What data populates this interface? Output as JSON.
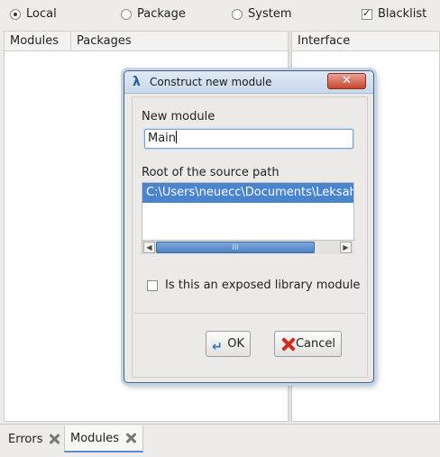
{
  "scope_options": [
    {
      "label": "Local",
      "selected": true
    },
    {
      "label": "Package",
      "selected": false
    },
    {
      "label": "System",
      "selected": false
    }
  ],
  "blacklist": {
    "label": "Blacklist",
    "checked": true
  },
  "left_pane": {
    "col_modules": "Modules",
    "col_packages": "Packages"
  },
  "right_pane": {
    "col_interface": "Interface"
  },
  "bottom_tabs": [
    {
      "label": "Errors",
      "active": false
    },
    {
      "label": "Modules",
      "active": true
    }
  ],
  "dialog": {
    "title": "Construct new module",
    "title_icon": "λ",
    "close_glyph": "✕",
    "new_module_label": "New module",
    "new_module_value": "Main",
    "root_label": "Root of the source path",
    "source_paths": [
      "C:\\Users\\neuecc\\Documents\\Leksah"
    ],
    "scroll_grip": "III",
    "exposed_label": "Is this an exposed library module",
    "exposed_checked": false,
    "ok_label": "OK",
    "cancel_label": "Cancel"
  },
  "colors": {
    "selection": "#4a84cf",
    "close_button": "#c7452f",
    "cancel_icon": "#d02a1e"
  }
}
